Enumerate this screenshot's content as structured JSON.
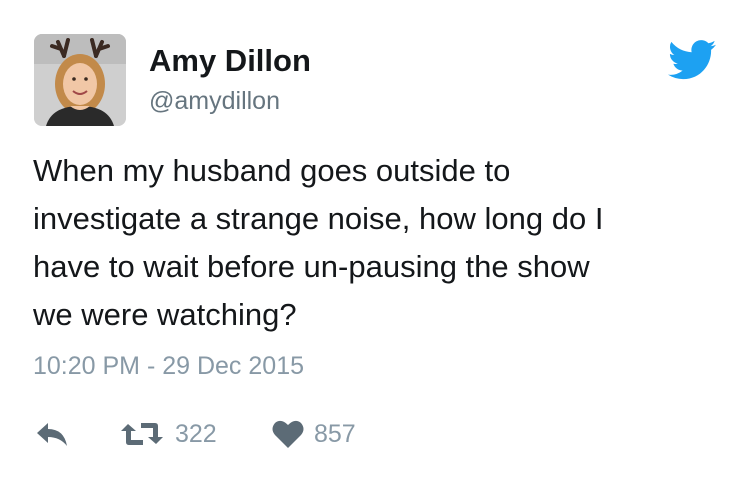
{
  "tweet": {
    "author_name": "Amy Dillon",
    "author_handle": "@amydillon",
    "text_lines": [
      "When my husband goes outside to",
      "investigate a strange noise, how long do I",
      "have to wait before un-pausing the show",
      "we were watching?"
    ],
    "timestamp": "10:20 PM - 29 Dec 2015",
    "retweet_count": "322",
    "like_count": "857"
  },
  "icons": {
    "brand": "twitter-bird-icon",
    "reply": "reply-icon",
    "retweet": "retweet-icon",
    "like": "heart-icon"
  },
  "colors": {
    "brand_blue": "#1da1f2",
    "text": "#14171a",
    "secondary": "#66757f",
    "muted": "#8899a6",
    "icon_gray": "#5c6b76"
  }
}
